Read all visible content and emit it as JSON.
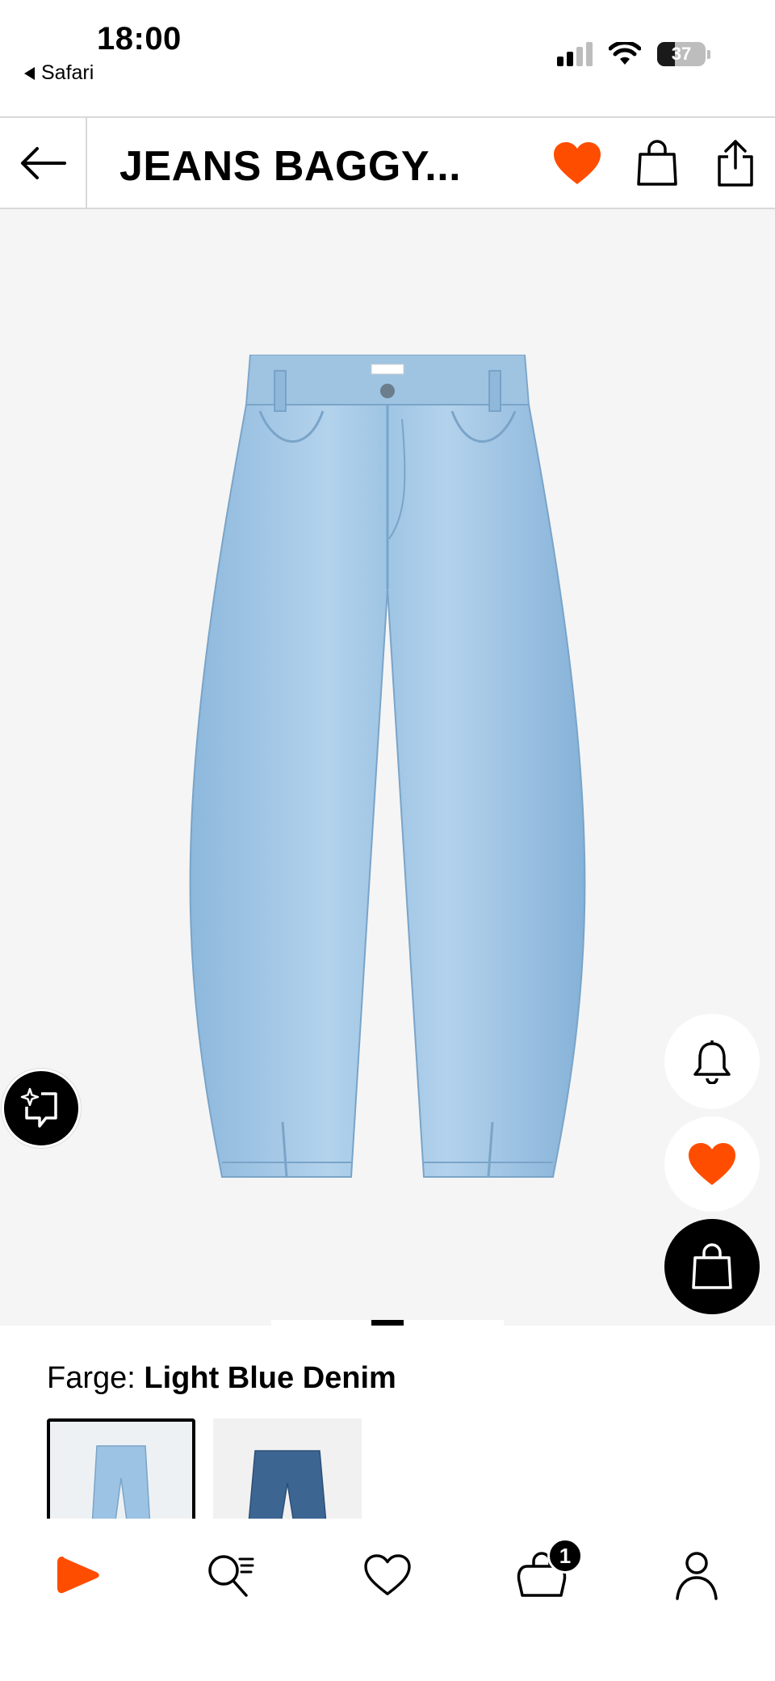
{
  "status_bar": {
    "time": "18:00",
    "back_app": "Safari",
    "battery": "37",
    "battery_level": 0.37
  },
  "header": {
    "title": "JEANS BAGGY..."
  },
  "product": {
    "color_label": "Farge:",
    "color_value": "Light Blue Denim",
    "swatches": [
      {
        "name": "Light Blue Denim",
        "color": "#9cc3e3",
        "selected": true
      },
      {
        "name": "Dark Blue Denim",
        "color": "#3d6592",
        "selected": false
      }
    ],
    "carousel": {
      "active_index": 0
    }
  },
  "bottom_nav": {
    "cart_count": "1"
  },
  "colors": {
    "accent": "#ff4d00",
    "denim_light": "#a9cbe8",
    "denim_shadow": "#7fa9cf",
    "background": "#f5f5f5"
  },
  "icons": {
    "back": "arrow-left-icon",
    "favorite": "heart-filled-icon",
    "cart": "shopping-bag-icon",
    "share": "share-icon",
    "notify": "bell-icon",
    "ai": "sparkle-chat-icon",
    "home": "play-logo-icon",
    "search": "search-list-icon",
    "wishlist": "heart-outline-icon",
    "bag": "bag-icon",
    "profile": "person-icon"
  }
}
